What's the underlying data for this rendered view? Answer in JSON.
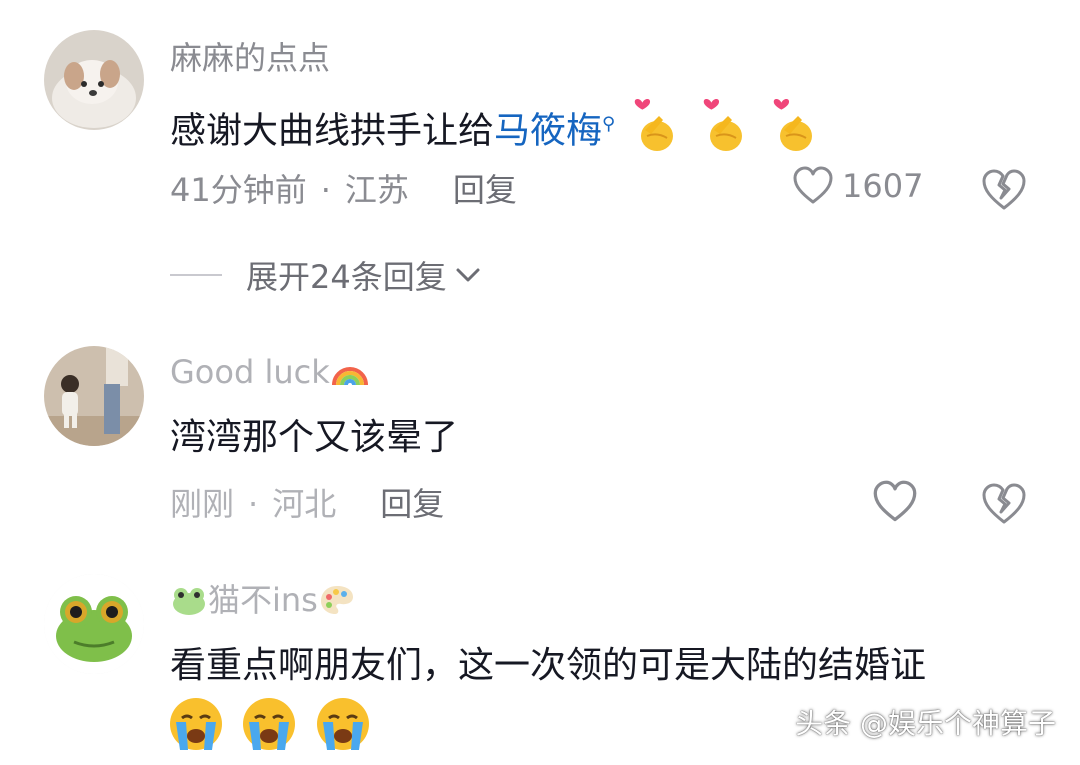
{
  "comments": [
    {
      "username": "麻麻的点点",
      "text_before": "感谢大曲线拱手让给",
      "mention": "马筱梅",
      "emoji_icons": [
        "finger-heart-emoji-icon",
        "finger-heart-emoji-icon",
        "finger-heart-emoji-icon"
      ],
      "time": "41分钟前",
      "location": "江苏",
      "reply_label": "回复",
      "like_count": "1607",
      "expand_label": "展开24条回复"
    },
    {
      "username": "Good luck",
      "username_emoji": "rainbow-icon",
      "text": "湾湾那个又该晕了",
      "time": "刚刚",
      "location": "河北",
      "reply_label": "回复"
    },
    {
      "username_prefix_emoji": "frog-icon",
      "username": "猫不ins",
      "username_emoji": "palette-icon",
      "text": "看重点啊朋友们，这一次领的可是大陆的结婚证",
      "emoji_icons": [
        "crying-face-icon",
        "crying-face-icon",
        "crying-face-icon"
      ]
    }
  ],
  "separator_dot": "·",
  "watermark": "头条 @娱乐个神算子",
  "colors": {
    "username": "#8a8b91",
    "text": "#161823",
    "mention": "#1565c0",
    "meta": "#8a8b91"
  }
}
